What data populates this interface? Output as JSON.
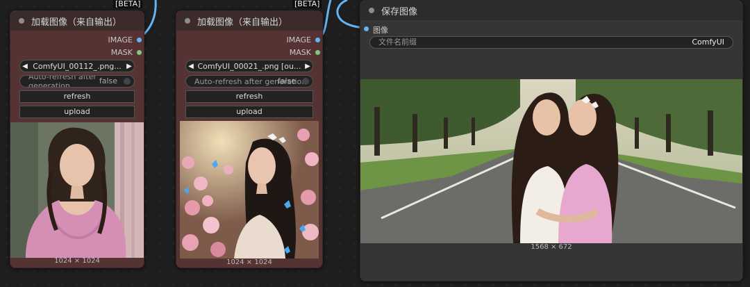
{
  "beta_badges": [
    "[BETA]",
    "[BETA]"
  ],
  "load_nodes": [
    {
      "title": "加载图像（来自输出）",
      "outputs": [
        "IMAGE",
        "MASK"
      ],
      "image_combo": "ComfyUI_00112_.png...",
      "auto_refresh_label": "Auto-refresh after generation",
      "auto_refresh_value": "false",
      "refresh_label": "refresh",
      "upload_label": "upload",
      "dims": "1024 × 1024"
    },
    {
      "title": "加载图像（来自输出）",
      "outputs": [
        "IMAGE",
        "MASK"
      ],
      "image_combo": "ComfyUI_00021_.png [ou...",
      "auto_refresh_label": "Auto-refresh after generation",
      "auto_refresh_value": "false",
      "refresh_label": "refresh",
      "upload_label": "upload",
      "dims": "1024 × 1024"
    }
  ],
  "save_node": {
    "title": "保存图像",
    "input": "图像",
    "prefix_label": "文件名前缀",
    "prefix_value": "ComfyUI",
    "dims": "1568 × 672"
  },
  "colors": {
    "image_slot": "#64b5f6",
    "mask_slot": "#81c784",
    "wire": "#64b5f6"
  }
}
